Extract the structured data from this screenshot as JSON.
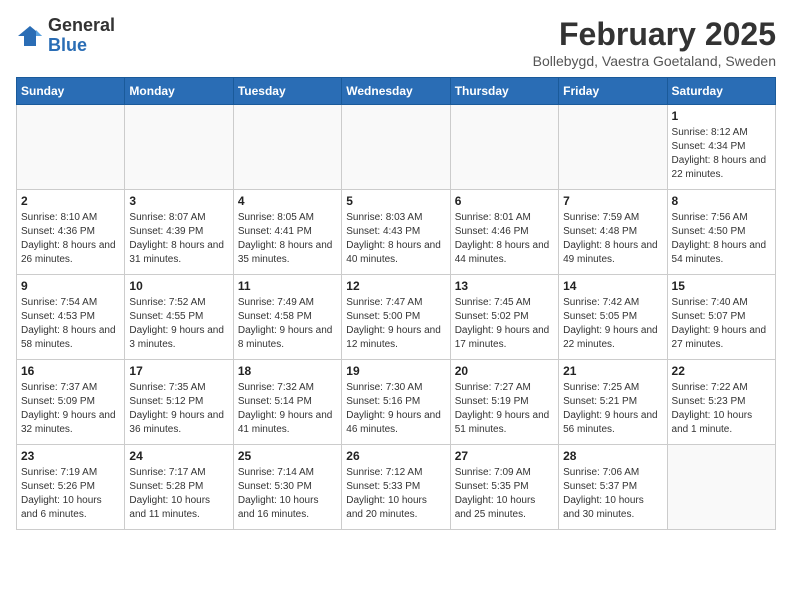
{
  "logo": {
    "general": "General",
    "blue": "Blue"
  },
  "header": {
    "month": "February 2025",
    "location": "Bollebygd, Vaestra Goetaland, Sweden"
  },
  "weekdays": [
    "Sunday",
    "Monday",
    "Tuesday",
    "Wednesday",
    "Thursday",
    "Friday",
    "Saturday"
  ],
  "weeks": [
    [
      {
        "day": "",
        "info": ""
      },
      {
        "day": "",
        "info": ""
      },
      {
        "day": "",
        "info": ""
      },
      {
        "day": "",
        "info": ""
      },
      {
        "day": "",
        "info": ""
      },
      {
        "day": "",
        "info": ""
      },
      {
        "day": "1",
        "info": "Sunrise: 8:12 AM\nSunset: 4:34 PM\nDaylight: 8 hours and 22 minutes."
      }
    ],
    [
      {
        "day": "2",
        "info": "Sunrise: 8:10 AM\nSunset: 4:36 PM\nDaylight: 8 hours and 26 minutes."
      },
      {
        "day": "3",
        "info": "Sunrise: 8:07 AM\nSunset: 4:39 PM\nDaylight: 8 hours and 31 minutes."
      },
      {
        "day": "4",
        "info": "Sunrise: 8:05 AM\nSunset: 4:41 PM\nDaylight: 8 hours and 35 minutes."
      },
      {
        "day": "5",
        "info": "Sunrise: 8:03 AM\nSunset: 4:43 PM\nDaylight: 8 hours and 40 minutes."
      },
      {
        "day": "6",
        "info": "Sunrise: 8:01 AM\nSunset: 4:46 PM\nDaylight: 8 hours and 44 minutes."
      },
      {
        "day": "7",
        "info": "Sunrise: 7:59 AM\nSunset: 4:48 PM\nDaylight: 8 hours and 49 minutes."
      },
      {
        "day": "8",
        "info": "Sunrise: 7:56 AM\nSunset: 4:50 PM\nDaylight: 8 hours and 54 minutes."
      }
    ],
    [
      {
        "day": "9",
        "info": "Sunrise: 7:54 AM\nSunset: 4:53 PM\nDaylight: 8 hours and 58 minutes."
      },
      {
        "day": "10",
        "info": "Sunrise: 7:52 AM\nSunset: 4:55 PM\nDaylight: 9 hours and 3 minutes."
      },
      {
        "day": "11",
        "info": "Sunrise: 7:49 AM\nSunset: 4:58 PM\nDaylight: 9 hours and 8 minutes."
      },
      {
        "day": "12",
        "info": "Sunrise: 7:47 AM\nSunset: 5:00 PM\nDaylight: 9 hours and 12 minutes."
      },
      {
        "day": "13",
        "info": "Sunrise: 7:45 AM\nSunset: 5:02 PM\nDaylight: 9 hours and 17 minutes."
      },
      {
        "day": "14",
        "info": "Sunrise: 7:42 AM\nSunset: 5:05 PM\nDaylight: 9 hours and 22 minutes."
      },
      {
        "day": "15",
        "info": "Sunrise: 7:40 AM\nSunset: 5:07 PM\nDaylight: 9 hours and 27 minutes."
      }
    ],
    [
      {
        "day": "16",
        "info": "Sunrise: 7:37 AM\nSunset: 5:09 PM\nDaylight: 9 hours and 32 minutes."
      },
      {
        "day": "17",
        "info": "Sunrise: 7:35 AM\nSunset: 5:12 PM\nDaylight: 9 hours and 36 minutes."
      },
      {
        "day": "18",
        "info": "Sunrise: 7:32 AM\nSunset: 5:14 PM\nDaylight: 9 hours and 41 minutes."
      },
      {
        "day": "19",
        "info": "Sunrise: 7:30 AM\nSunset: 5:16 PM\nDaylight: 9 hours and 46 minutes."
      },
      {
        "day": "20",
        "info": "Sunrise: 7:27 AM\nSunset: 5:19 PM\nDaylight: 9 hours and 51 minutes."
      },
      {
        "day": "21",
        "info": "Sunrise: 7:25 AM\nSunset: 5:21 PM\nDaylight: 9 hours and 56 minutes."
      },
      {
        "day": "22",
        "info": "Sunrise: 7:22 AM\nSunset: 5:23 PM\nDaylight: 10 hours and 1 minute."
      }
    ],
    [
      {
        "day": "23",
        "info": "Sunrise: 7:19 AM\nSunset: 5:26 PM\nDaylight: 10 hours and 6 minutes."
      },
      {
        "day": "24",
        "info": "Sunrise: 7:17 AM\nSunset: 5:28 PM\nDaylight: 10 hours and 11 minutes."
      },
      {
        "day": "25",
        "info": "Sunrise: 7:14 AM\nSunset: 5:30 PM\nDaylight: 10 hours and 16 minutes."
      },
      {
        "day": "26",
        "info": "Sunrise: 7:12 AM\nSunset: 5:33 PM\nDaylight: 10 hours and 20 minutes."
      },
      {
        "day": "27",
        "info": "Sunrise: 7:09 AM\nSunset: 5:35 PM\nDaylight: 10 hours and 25 minutes."
      },
      {
        "day": "28",
        "info": "Sunrise: 7:06 AM\nSunset: 5:37 PM\nDaylight: 10 hours and 30 minutes."
      },
      {
        "day": "",
        "info": ""
      }
    ]
  ]
}
